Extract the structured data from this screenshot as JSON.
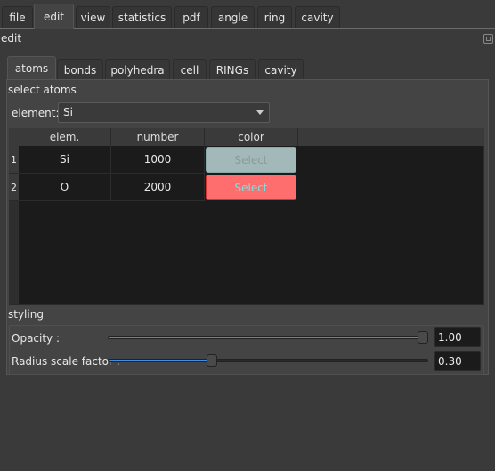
{
  "main_tabs": [
    "file",
    "edit",
    "view",
    "statistics",
    "pdf",
    "angle",
    "ring",
    "cavity"
  ],
  "selected_main_tab": "edit",
  "panel_title": "edit",
  "sub_tabs": [
    "atoms",
    "bonds",
    "polyhedra",
    "cell",
    "RINGs",
    "cavity"
  ],
  "selected_sub_tab": "atoms",
  "select_atoms": {
    "title": "select atoms",
    "element_label": "element:",
    "element_value": "Si"
  },
  "table": {
    "columns": [
      "elem.",
      "number",
      "color"
    ],
    "rows": [
      {
        "index": "1",
        "elem": "Si",
        "number": "1000",
        "button": "Select",
        "color": "#a3b9b9",
        "text_color": "#8a9a9a"
      },
      {
        "index": "2",
        "elem": "O",
        "number": "2000",
        "button": "Select",
        "color": "#ff6e6e",
        "text_color": "#7fe0e0"
      }
    ]
  },
  "styling": {
    "title": "styling",
    "opacity": {
      "label": "Opacity :",
      "value": "1.00",
      "fraction": 1.0
    },
    "radius": {
      "label": "Radius scale factor :",
      "value": "0.30",
      "fraction": 0.3
    }
  },
  "accent": "#3d8fe6"
}
